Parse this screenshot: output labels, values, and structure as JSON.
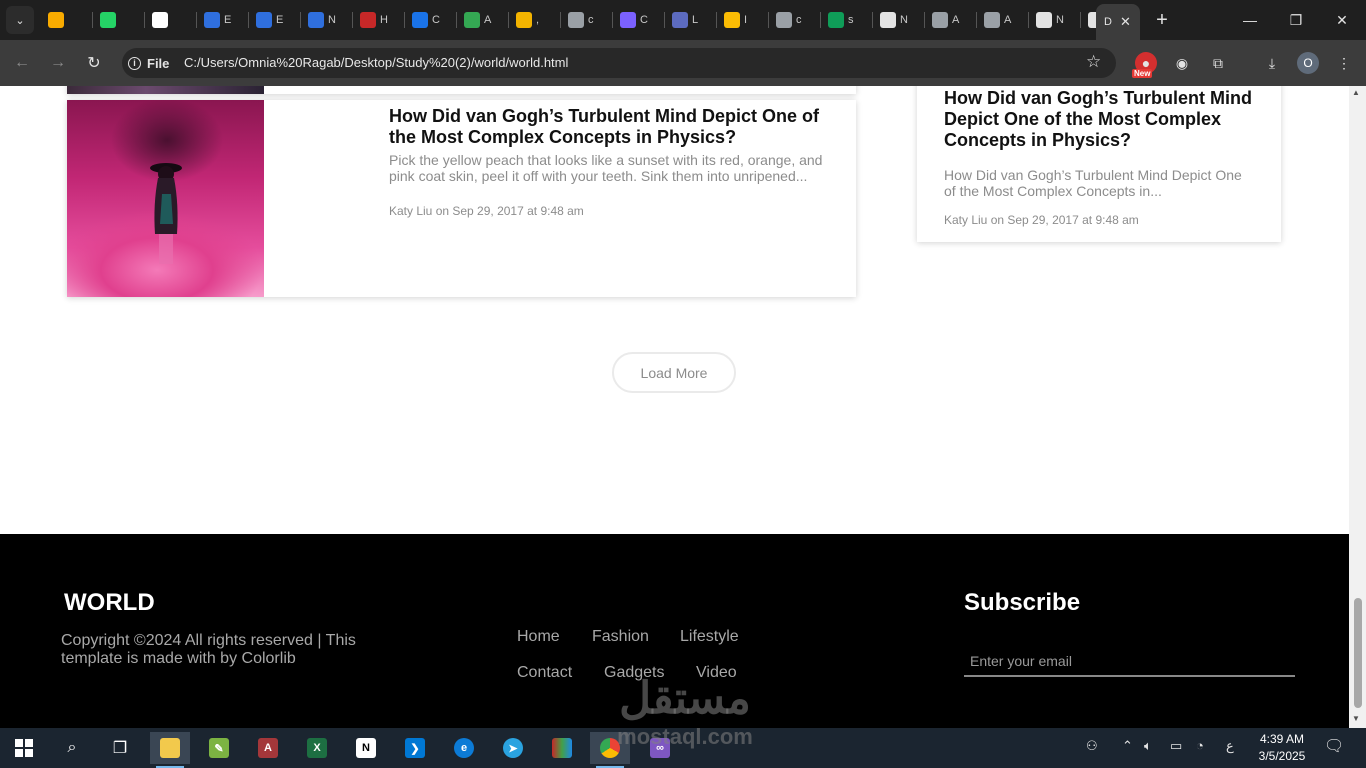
{
  "browser": {
    "tabs": [
      {
        "icon": "tab-icon-cube",
        "title": "",
        "color": "#f9ab00"
      },
      {
        "icon": "whatsapp-icon",
        "title": "",
        "color": "#25d366"
      },
      {
        "icon": "openai-icon",
        "title": "",
        "color": "#ffffff"
      },
      {
        "icon": "notion-n-icon",
        "title": "E",
        "color": "#2f6fde"
      },
      {
        "icon": "notion-n-icon",
        "title": "E",
        "color": "#2f6fde"
      },
      {
        "icon": "notion-n-icon",
        "title": "N",
        "color": "#2f6fde"
      },
      {
        "icon": "hsu-icon",
        "title": "H",
        "color": "#c62828"
      },
      {
        "icon": "chart-icon",
        "title": "C",
        "color": "#1a73e8"
      },
      {
        "icon": "drive-icon",
        "title": "A",
        "color": "#34a853"
      },
      {
        "icon": "five-icon",
        "title": ",",
        "color": "#f4b400"
      },
      {
        "icon": "globe-icon",
        "title": "c",
        "color": "#9aa0a6"
      },
      {
        "icon": "sketch-icon",
        "title": "C",
        "color": "#7b61ff"
      },
      {
        "icon": "meet-icon",
        "title": "L",
        "color": "#5c6bc0"
      },
      {
        "icon": "slides-icon",
        "title": "I",
        "color": "#fbbc04"
      },
      {
        "icon": "globe-icon",
        "title": "c",
        "color": "#9aa0a6"
      },
      {
        "icon": "classroom-icon",
        "title": "s",
        "color": "#0f9d58"
      },
      {
        "icon": "github-icon",
        "title": "N",
        "color": "#e3e3e3"
      },
      {
        "icon": "globe-icon",
        "title": "A",
        "color": "#9aa0a6"
      },
      {
        "icon": "globe-icon",
        "title": "A",
        "color": "#9aa0a6"
      },
      {
        "icon": "github-icon",
        "title": "N",
        "color": "#e3e3e3"
      },
      {
        "icon": "github-icon",
        "title": "N",
        "color": "#e3e3e3"
      }
    ],
    "active_tab_title": "D",
    "file_label": "File",
    "url": "C:/Users/Omnia%20Ragab/Desktop/Study%20(2)/world/world.html",
    "ext_new_badge": "New",
    "profile_initial": "O"
  },
  "page": {
    "main_article": {
      "title": "How Did van Gogh’s Turbulent Mind Depict One of the Most Complex Concepts in Physics?",
      "excerpt": "Pick the yellow peach that looks like a sunset with its red, orange, and pink coat skin, peel it off with your teeth. Sink them into unripened...",
      "meta": "Katy Liu on Sep 29, 2017 at 9:48 am"
    },
    "side_article": {
      "title": "How Did van Gogh’s Turbulent Mind Depict One of the Most Complex Concepts in Physics?",
      "excerpt": "How Did van Gogh’s Turbulent Mind Depict One of the Most Complex Concepts in...",
      "meta": "Katy Liu on Sep 29, 2017 at 9:48 am"
    },
    "load_more": "Load More",
    "footer": {
      "brand": "WORLD",
      "copyright": "Copyright ©2024 All rights reserved | This template is made with by Colorlib",
      "links": [
        "Home",
        "Fashion",
        "Lifestyle",
        "Contact",
        "Gadgets",
        "Video"
      ],
      "subscribe_title": "Subscribe",
      "email_placeholder": "Enter your email"
    }
  },
  "watermark": {
    "arabic": "مستقل",
    "latin": "mostaql.com"
  },
  "taskbar": {
    "apps": [
      "windows-start-icon",
      "search-icon",
      "task-view-icon",
      "file-explorer-icon",
      "notepad-icon",
      "access-icon",
      "excel-icon",
      "notion-icon",
      "vscode-icon",
      "edge-icon",
      "telegram-icon",
      "winrar-icon",
      "chrome-icon",
      "visual-studio-icon"
    ],
    "time": "4:39 AM",
    "date": "3/5/2025",
    "lang": "ع"
  },
  "colors": {
    "footer_bg": "#000000",
    "tabstrip_bg": "#1f1f1f",
    "toolbar_bg": "#3c3c3c",
    "taskbar_bg": "#1b2530"
  }
}
